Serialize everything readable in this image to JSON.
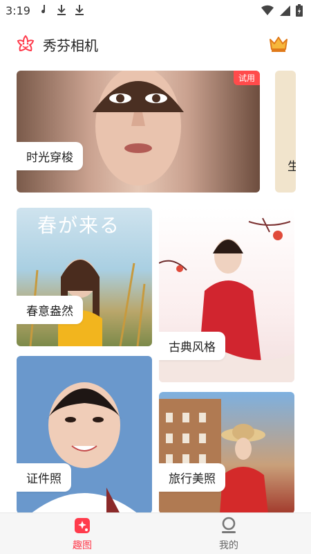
{
  "status_bar": {
    "time": "3:19"
  },
  "header": {
    "title": "秀芬相机"
  },
  "cards": {
    "hero": {
      "label": "时光穿梭",
      "badge": "试用"
    },
    "peek": {
      "label": "生"
    },
    "spring": {
      "label": "春意盎然",
      "art_title": "春が来る"
    },
    "classic": {
      "label": "古典风格"
    },
    "id_photo": {
      "label": "证件照"
    },
    "travel": {
      "label": "旅行美照"
    }
  },
  "tabbar": {
    "items": [
      {
        "label": "趣图",
        "active": true
      },
      {
        "label": "我的",
        "active": false
      }
    ]
  },
  "colors": {
    "accent": "#ff3b4c",
    "badge": "#ff4b4b",
    "crown": "#e07a1a"
  },
  "icons": [
    "music-note-icon",
    "download-icon",
    "wifi-icon",
    "signal-icon",
    "battery-icon",
    "app-logo-icon",
    "crown-icon",
    "fun-image-icon",
    "profile-icon"
  ]
}
